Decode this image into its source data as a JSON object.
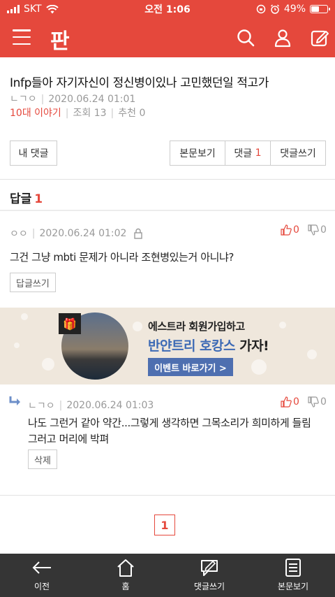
{
  "status_bar": {
    "carrier": "SKT",
    "time": "오전 1:06",
    "battery": "49%",
    "battery_level": 0.49
  },
  "header": {
    "logo": "판"
  },
  "post": {
    "title": "Infp들아 자기자신이 정신병이있나 고민했던일 적고가",
    "author": "ㄴㄱㅇ",
    "datetime": "2020.06.24 01:01",
    "category": "10대 이야기",
    "views": "조회 13",
    "likes": "추천 0"
  },
  "actions": {
    "my_comments": "내 댓글",
    "view_post": "본문보기",
    "comments_label": "댓글",
    "comments_count": "1",
    "write_comment": "댓글쓰기"
  },
  "replies": {
    "label": "답글",
    "count": "1"
  },
  "comments": [
    {
      "author": "ㅇㅇ",
      "datetime": "2020.06.24 01:02",
      "text": "그건 그냥 mbti 문제가 아니라 조현병있는거 아니냐?",
      "up": "0",
      "down": "0",
      "button": "답글쓰기"
    }
  ],
  "ad": {
    "line1": "에스트라 회원가입하고",
    "line2_prefix": "반얀트리 호캉스",
    "line2_suffix": " 가자!",
    "cta": "이벤트 바로가기 >"
  },
  "reply": {
    "author": "ㄴㄱㅇ",
    "datetime": "2020.06.24 01:03",
    "text_line1": "나도 그런거 같아 약간...그렇게 생각하면 그목소리가 희미하게 들림",
    "text_line2": "그러고 머리에 박펴",
    "up": "0",
    "down": "0",
    "button": "삭제"
  },
  "pagination": {
    "current": "1"
  },
  "bottom_nav": [
    {
      "label": "이전"
    },
    {
      "label": "홈"
    },
    {
      "label": "댓글쓰기"
    },
    {
      "label": "본문보기"
    }
  ],
  "colors": {
    "brand": "#e5483c",
    "ad_accent": "#3d6ab5",
    "bottom_bar": "#353535"
  }
}
